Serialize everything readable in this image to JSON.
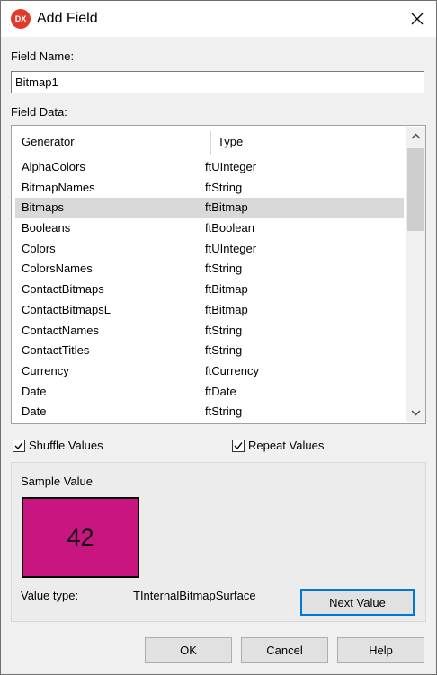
{
  "window": {
    "title": "Add Field",
    "icon_text": "DX"
  },
  "field_name": {
    "label": "Field Name:",
    "value": "Bitmap1"
  },
  "field_data": {
    "label": "Field Data:",
    "columns": [
      "Generator",
      "Type"
    ],
    "rows": [
      {
        "generator": "AlphaColors",
        "type": "ftUInteger"
      },
      {
        "generator": "BitmapNames",
        "type": "ftString"
      },
      {
        "generator": "Bitmaps",
        "type": "ftBitmap"
      },
      {
        "generator": "Booleans",
        "type": "ftBoolean"
      },
      {
        "generator": "Colors",
        "type": "ftUInteger"
      },
      {
        "generator": "ColorsNames",
        "type": "ftString"
      },
      {
        "generator": "ContactBitmaps",
        "type": "ftBitmap"
      },
      {
        "generator": "ContactBitmapsL",
        "type": "ftBitmap"
      },
      {
        "generator": "ContactNames",
        "type": "ftString"
      },
      {
        "generator": "ContactTitles",
        "type": "ftString"
      },
      {
        "generator": "Currency",
        "type": "ftCurrency"
      },
      {
        "generator": "Date",
        "type": "ftDate"
      },
      {
        "generator": "Date",
        "type": "ftString"
      }
    ],
    "selected_generator": "Bitmaps"
  },
  "options": {
    "shuffle_label": "Shuffle Values",
    "shuffle_checked": true,
    "repeat_label": "Repeat Values",
    "repeat_checked": true
  },
  "sample": {
    "label": "Sample Value",
    "value_text": "42",
    "swatch_color": "#c8157f",
    "value_type_label": "Value type:",
    "value_type": "TInternalBitmapSurface",
    "next_button": "Next Value"
  },
  "buttons": {
    "ok": "OK",
    "cancel": "Cancel",
    "help": "Help"
  },
  "colors": {
    "accent": "#0078d7",
    "selection": "#d9d9d9",
    "icon": "#e03a2d"
  }
}
